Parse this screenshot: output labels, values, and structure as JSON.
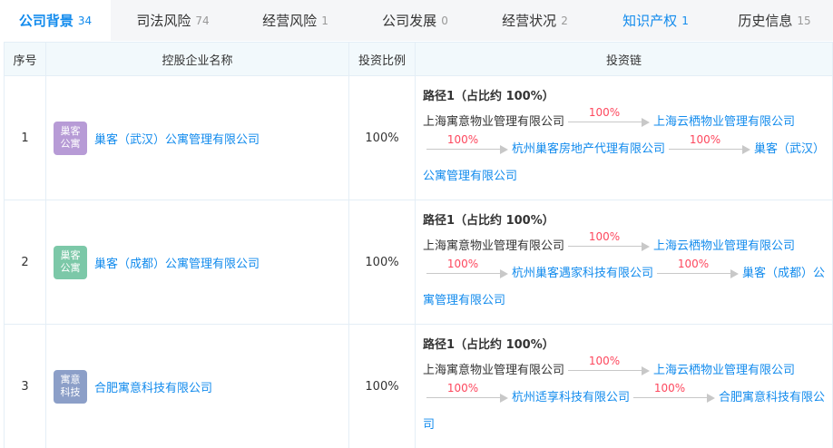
{
  "tabs": [
    {
      "label": "公司背景",
      "count": "34"
    },
    {
      "label": "司法风险",
      "count": "74"
    },
    {
      "label": "经营风险",
      "count": "1"
    },
    {
      "label": "公司发展",
      "count": "0"
    },
    {
      "label": "经营状况",
      "count": "2"
    },
    {
      "label": "知识产权",
      "count": "1"
    },
    {
      "label": "历史信息",
      "count": "15"
    }
  ],
  "table": {
    "headers": {
      "index": "序号",
      "company": "控股企业名称",
      "ratio": "投资比例",
      "chain": "投资链"
    },
    "rows": [
      {
        "index": "1",
        "logo_text": "巢客公寓",
        "logo_color": "#b79bd6",
        "company": "巢客（武汉）公寓管理有限公司",
        "ratio": "100%",
        "path_title": "路径1（占比约 100%）",
        "start": "上海寓意物业管理有限公司",
        "pct1": "100%",
        "node1": "上海云栖物业管理有限公司",
        "pct2": "100%",
        "node2": "杭州巢客房地产代理有限公司",
        "pct3": "100%",
        "node3": "巢客（武汉）公寓管理有限公司"
      },
      {
        "index": "2",
        "logo_text": "巢客公寓",
        "logo_color": "#7cc8a8",
        "company": "巢客（成都）公寓管理有限公司",
        "ratio": "100%",
        "path_title": "路径1（占比约 100%）",
        "start": "上海寓意物业管理有限公司",
        "pct1": "100%",
        "node1": "上海云栖物业管理有限公司",
        "pct2": "100%",
        "node2": "杭州巢客遇家科技有限公司",
        "pct3": "100%",
        "node3": "巢客（成都）公寓管理有限公司"
      },
      {
        "index": "3",
        "logo_text": "寓意科技",
        "logo_color": "#8c9fc8",
        "company": "合肥寓意科技有限公司",
        "ratio": "100%",
        "path_title": "路径1（占比约 100%）",
        "start": "上海寓意物业管理有限公司",
        "pct1": "100%",
        "node1": "上海云栖物业管理有限公司",
        "pct2": "100%",
        "node2": "杭州适享科技有限公司",
        "pct3": "100%",
        "node3": "合肥寓意科技有限公司"
      }
    ]
  },
  "colors": {
    "accent": "#128bed",
    "percent": "#fd485e",
    "header_bg": "#f2f9fc",
    "tab_bg": "#f5f6f8"
  }
}
